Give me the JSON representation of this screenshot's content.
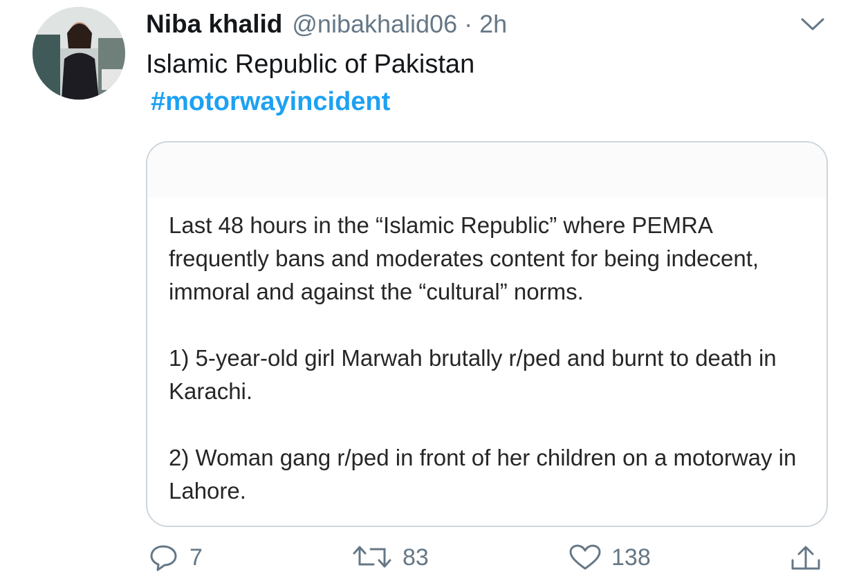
{
  "tweet": {
    "author_name": "Niba khalid",
    "handle": "@nibakhalid06",
    "separator": "·",
    "time": "2h",
    "text": "Islamic Republic of Pakistan",
    "hashtag": "#motorwayincident",
    "hashtag_color": "#1da1f2",
    "menu_icon": "chevron-down-icon"
  },
  "card": {
    "paragraphs": [
      "Last 48 hours in the “Islamic Republic” where PEMRA frequently bans and moderates content for being indecent, immoral and against the “cultural” norms.",
      "1) 5-year-old girl Marwah brutally r/ped and burnt to death in Karachi.",
      "2) Woman gang r/ped in front of her children on a motorway in Lahore."
    ]
  },
  "actions": {
    "reply": {
      "icon": "reply-icon",
      "count": "7"
    },
    "retweet": {
      "icon": "retweet-icon",
      "count": "83"
    },
    "like": {
      "icon": "heart-icon",
      "count": "138"
    },
    "share": {
      "icon": "share-icon"
    }
  },
  "colors": {
    "text": "#14171a",
    "secondary": "#657786",
    "border": "#ccd6dd"
  }
}
